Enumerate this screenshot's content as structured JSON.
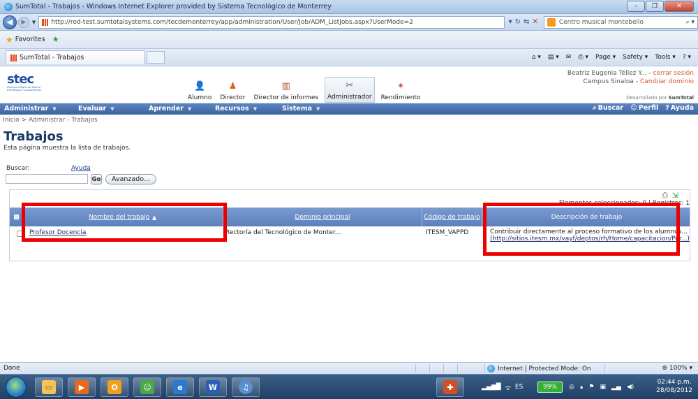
{
  "window": {
    "title": "SumTotal - Trabajos - Windows Internet Explorer provided by Sistema Tecnológico de Monterrey",
    "url": "http://rod-test.sumtotalsystems.com/tecdemonterrey/app/administration/User/Job/ADM_ListJobs.aspx?UserMode=2",
    "search_text": "Centro musical montebello",
    "favorites_label": "Favorites",
    "tab_title": "SumTotal - Trabajos",
    "commands": [
      "Page ▾",
      "Safety ▾",
      "Tools ▾"
    ]
  },
  "header": {
    "logo_text": "stec",
    "logo_sub": "Sistema Integral de Talento Estratégico y Competencias",
    "roles": [
      {
        "label": "Alumno",
        "icon": "student-icon"
      },
      {
        "label": "Director",
        "icon": "director-icon"
      },
      {
        "label": "Director de informes",
        "icon": "reports-icon"
      },
      {
        "label": "Administrador",
        "icon": "tools-icon"
      },
      {
        "label": "Rendimiento",
        "icon": "performance-icon"
      }
    ],
    "user_name": "Beatriz Eugenia Téllez Y... -",
    "logout": "cerrar sesión",
    "campus": "Campus Sinaloa -",
    "change_domain": "Cambiar dominio",
    "powered_prefix": "Desarrollado por",
    "powered_brand": "SumTotal"
  },
  "menu": {
    "items": [
      "Administrar",
      "Evaluar",
      "Aprender",
      "Recursos",
      "Sistema"
    ],
    "right": {
      "search": "Buscar",
      "profile": "Perfil",
      "help": "Ayuda"
    }
  },
  "page": {
    "breadcrumb": "Inicio > Administrar - Trabajos",
    "title": "Trabajos",
    "description": "Esta página muestra la lista de trabajos.",
    "search_label": "Buscar:",
    "help_link": "Ayuda",
    "search_value": "",
    "go_label": "Go",
    "advanced_label": "Avanzado..."
  },
  "grid": {
    "status": "Elementos seleccionados: 0 | Registros: 1",
    "columns": [
      "Nombre del trabajo",
      "Dominio principal",
      "Código de trabajo",
      "Descripción de trabajo"
    ],
    "sort_indicator": "▲",
    "rows": [
      {
        "name": "Profesor Docencia",
        "domain": "Rectoría del Tecnológico de Monter...",
        "code": "ITESM_VAPPD",
        "description": "Contribuir directamente al proceso formativo de los alumnos...",
        "description_link": "(http://sitios.itesm.mx/vayf/deptos/rh/Home/capacitacion/Per...)"
      }
    ]
  },
  "statusbar": {
    "left": "Done",
    "zone": "Internet | Protected Mode: On",
    "zoom": "100%"
  },
  "taskbar": {
    "language": "ES",
    "battery": "99%",
    "time": "02:44 p.m.",
    "date": "28/08/2012"
  },
  "colors": {
    "menu_bar": "#3c639f",
    "grid_header": "#5b80bd",
    "highlight": "#ee0000",
    "title": "#1b3866",
    "link_accent": "#d4542c"
  }
}
